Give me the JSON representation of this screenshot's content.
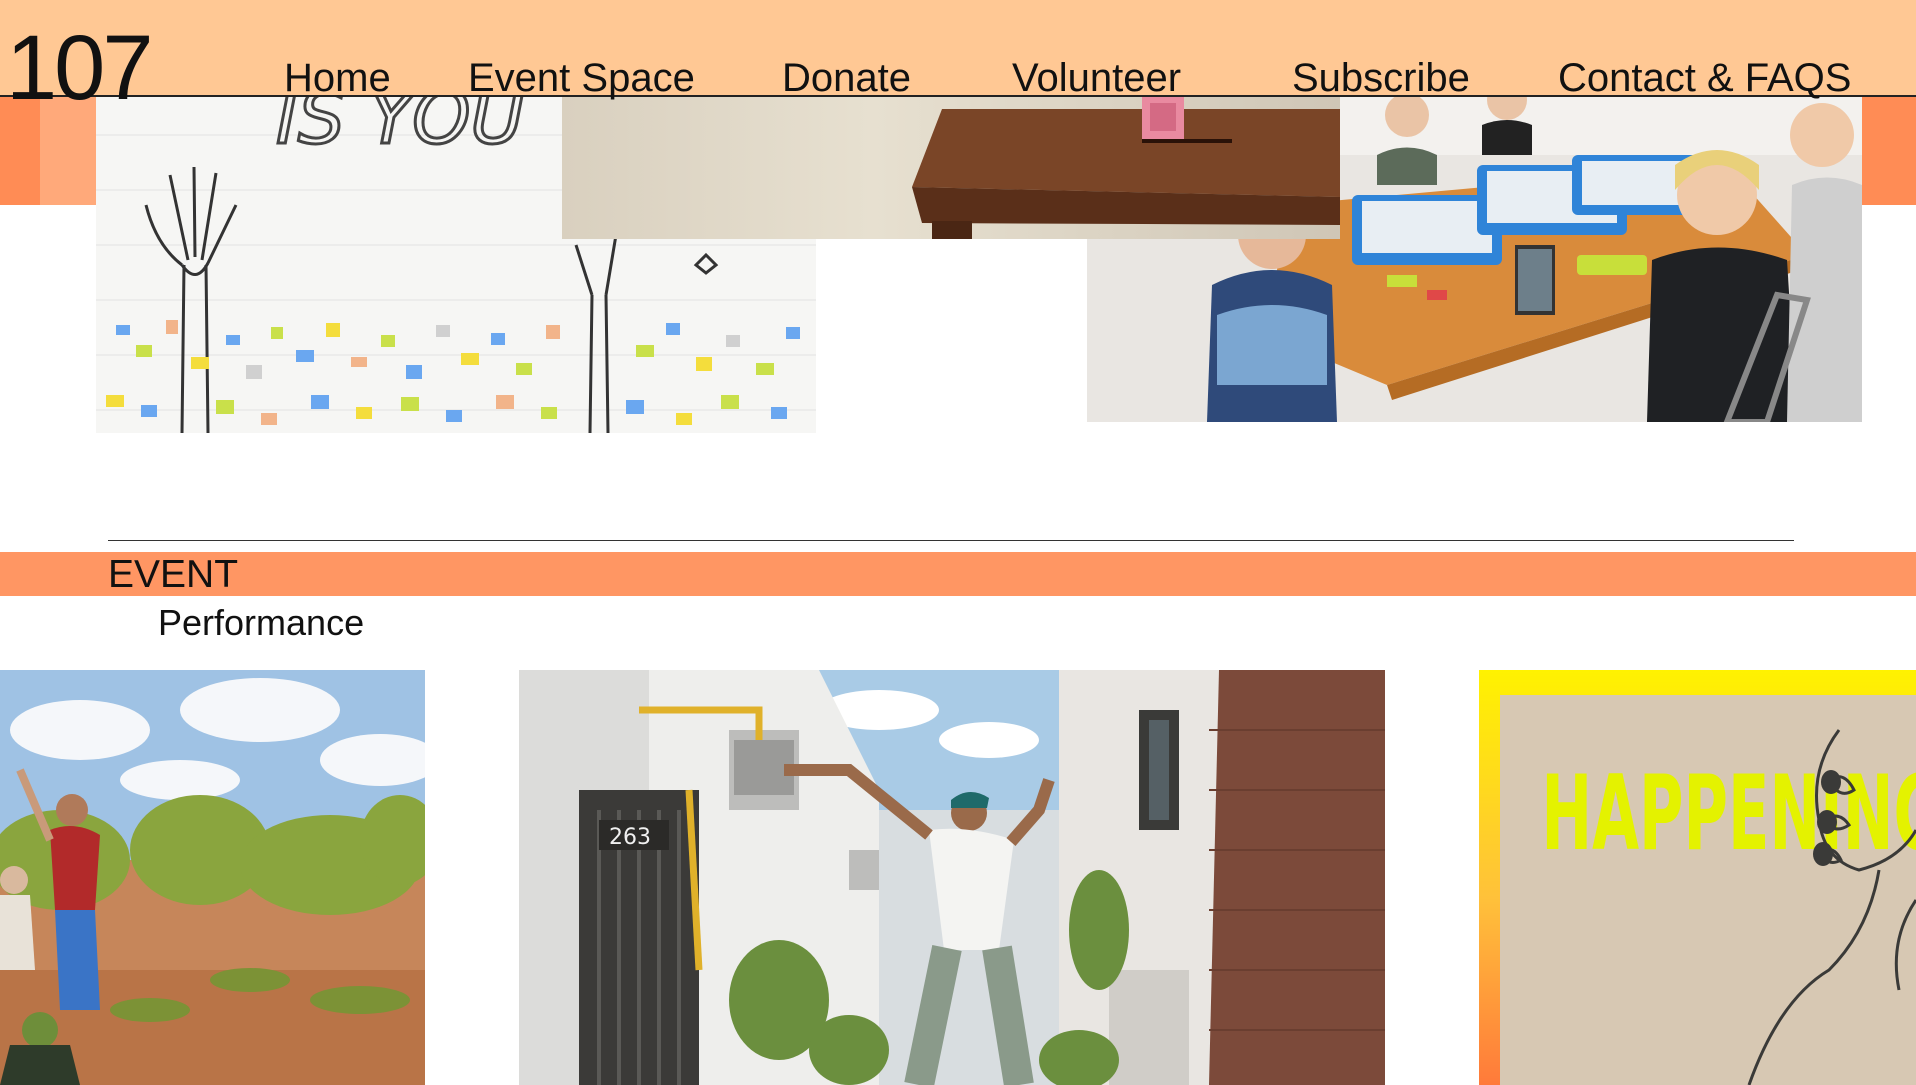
{
  "logo": "107",
  "nav": {
    "home": "Home",
    "event_space": "Event Space",
    "donate": "Donate",
    "volunteer": "Volunteer",
    "subscribe": "Subscribe",
    "contact": "Contact & FAQS"
  },
  "hero": {
    "mural_text": "IS YOU"
  },
  "section": {
    "label": "EVENT",
    "category": "Performance"
  },
  "cards": [
    {
      "image": "outdoor-dancers-photo"
    },
    {
      "image": "dancer-in-alley-photo",
      "door_number": "263"
    },
    {
      "image": "happenings-poster",
      "poster_title": "HAPPENINGS"
    }
  ],
  "colors": {
    "header": "#ffc894",
    "accent_orange": "#ff9663",
    "poster_yellow": "#fff200",
    "poster_text": "#e4f200"
  }
}
